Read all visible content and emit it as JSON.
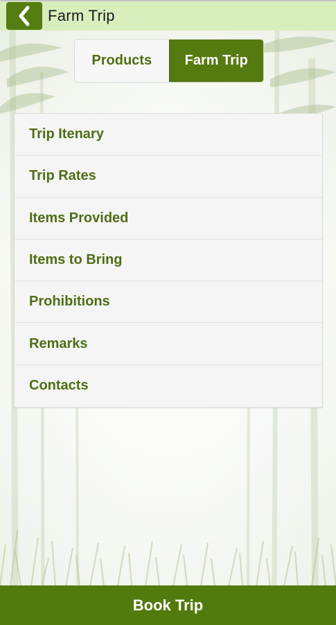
{
  "header": {
    "title": "Farm Trip",
    "back_icon": "chevron-left-icon"
  },
  "tabs": [
    {
      "label": "Products",
      "active": false
    },
    {
      "label": "Farm Trip",
      "active": true
    }
  ],
  "menu": {
    "items": [
      {
        "label": "Trip Itenary"
      },
      {
        "label": "Trip Rates"
      },
      {
        "label": "Items Provided"
      },
      {
        "label": "Items to Bring"
      },
      {
        "label": "Prohibitions"
      },
      {
        "label": "Remarks"
      },
      {
        "label": "Contacts"
      }
    ]
  },
  "footer": {
    "button_label": "Book Trip"
  },
  "colors": {
    "header_bg": "#d9eebd",
    "accent": "#557a0f",
    "text_green": "#4f6e16"
  }
}
